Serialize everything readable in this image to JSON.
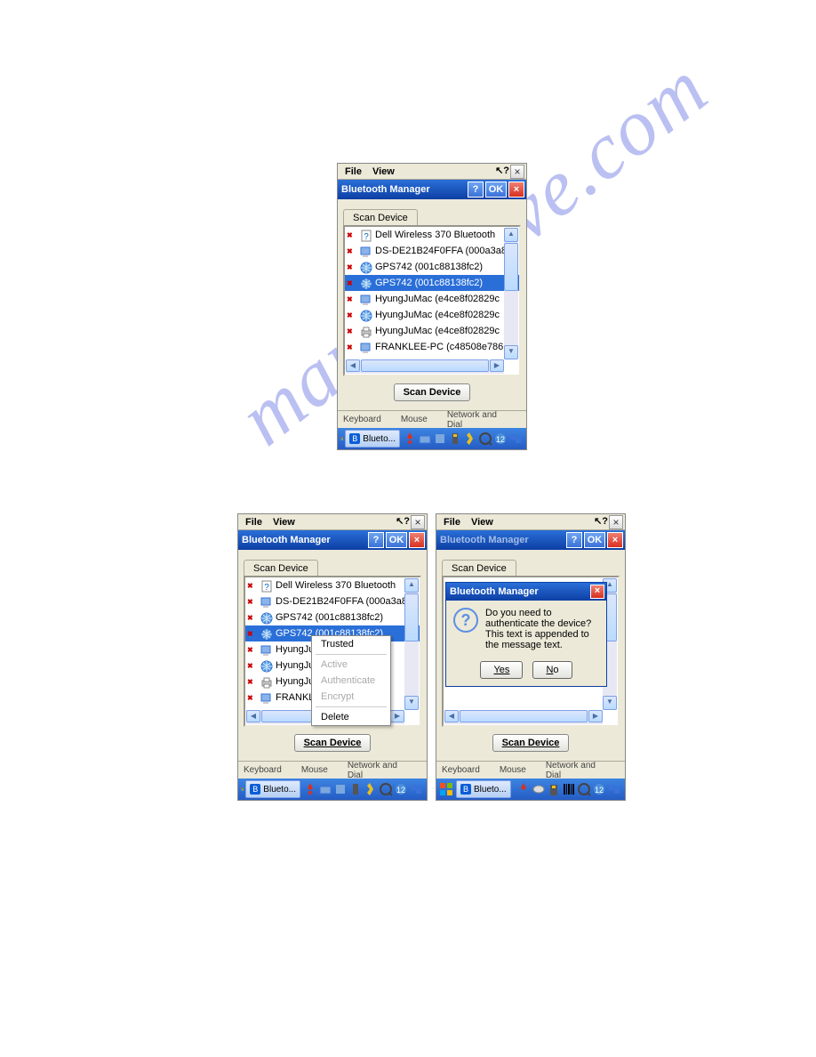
{
  "watermark": "manualslive.com",
  "menus": {
    "file": "File",
    "view": "View"
  },
  "window_title": "Bluetooth Manager",
  "tb_help": "?",
  "tb_ok": "OK",
  "tb_close": "×",
  "tab_label": "Scan Device",
  "scan_button": "Scan Device",
  "screens": {
    "s1": {
      "devices": [
        {
          "name": "Dell Wireless 370 Bluetooth",
          "type": "unknown",
          "selected": false
        },
        {
          "name": "DS-DE21B24F0FFA (000a3a8",
          "type": "pc",
          "selected": false
        },
        {
          "name": "GPS742 (001c88138fc2)",
          "type": "globe",
          "selected": false
        },
        {
          "name": "GPS742 (001c88138fc2)",
          "type": "globe",
          "selected": true
        },
        {
          "name": "HyungJuMac (e4ce8f02829c",
          "type": "pc",
          "selected": false
        },
        {
          "name": "HyungJuMac (e4ce8f02829c",
          "type": "globe",
          "selected": false
        },
        {
          "name": "HyungJuMac (e4ce8f02829c",
          "type": "printer",
          "selected": false
        },
        {
          "name": "FRANKLEE-PC (c48508e786",
          "type": "pc",
          "selected": false
        }
      ]
    },
    "s2": {
      "devices": [
        {
          "name": "Dell Wireless 370 Bluetooth",
          "type": "unknown",
          "selected": false
        },
        {
          "name": "DS-DE21B24F0FFA (000a3a8",
          "type": "pc",
          "selected": false
        },
        {
          "name": "GPS742 (001c88138fc2)",
          "type": "globe",
          "selected": false
        },
        {
          "name": "GPS742 (001c88138fc2)",
          "type": "globe",
          "selected": true,
          "partial": "GPS742"
        },
        {
          "name": "HyungJu",
          "type": "pc",
          "selected": false
        },
        {
          "name": "HyungJu",
          "type": "globe",
          "selected": false
        },
        {
          "name": "HyungJu",
          "type": "printer",
          "selected": false
        },
        {
          "name": "FRANKLE",
          "type": "pc",
          "selected": false
        }
      ],
      "context_menu": {
        "items": [
          {
            "label": "Trusted",
            "enabled": true
          },
          {
            "sep": true
          },
          {
            "label": "Active",
            "enabled": false
          },
          {
            "label": "Authenticate",
            "enabled": false
          },
          {
            "label": "Encrypt",
            "enabled": false
          },
          {
            "sep": true
          },
          {
            "label": "Delete",
            "enabled": true
          }
        ]
      }
    },
    "s3": {
      "msgbox": {
        "title": "Bluetooth Manager",
        "text": "Do you need to authenticate the device? This text is appended to the message text.",
        "yes": "Yes",
        "no": "No"
      }
    }
  },
  "below_strip": {
    "keyboard": "Keyboard",
    "mouse": "Mouse",
    "network": "Network and Dial"
  },
  "taskbar": {
    "app": "Blueto..."
  }
}
